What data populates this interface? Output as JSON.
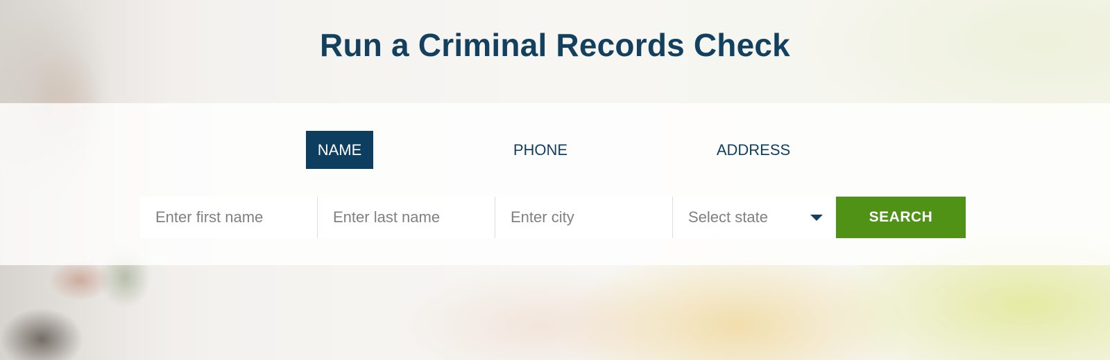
{
  "page": {
    "title": "Run a Criminal Records Check"
  },
  "tabs": [
    {
      "label": "NAME",
      "active": true
    },
    {
      "label": "PHONE",
      "active": false
    },
    {
      "label": "ADDRESS",
      "active": false
    }
  ],
  "form": {
    "first_name": {
      "placeholder": "Enter first name",
      "value": ""
    },
    "last_name": {
      "placeholder": "Enter last name",
      "value": ""
    },
    "city": {
      "placeholder": "Enter city",
      "value": ""
    },
    "state": {
      "selected": "Select state"
    },
    "search_label": "SEARCH"
  },
  "colors": {
    "title": "#12405e",
    "active_tab": "#0d3d5f",
    "search_button": "#4f9216"
  },
  "icons": {
    "state_dropdown": "caret-down-icon"
  }
}
